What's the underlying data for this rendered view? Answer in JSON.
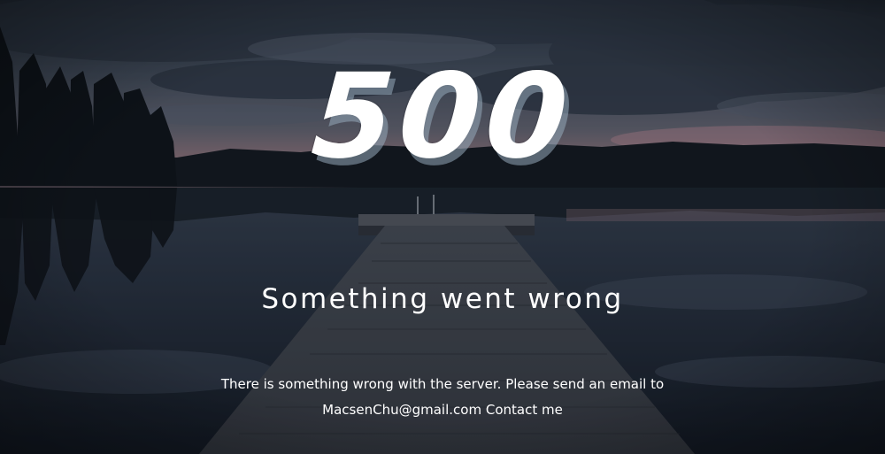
{
  "error_page": {
    "code": "500",
    "headline": "Something went wrong",
    "message_line1": "There is something wrong with the server. Please send an email to",
    "email": "MacsenChu@gmail.com",
    "contact_label": "Contact me"
  },
  "colors": {
    "text": "#ffffff",
    "sky_dark": "#1f2a38",
    "sunset": "#b98a8f",
    "water": "#27323f"
  }
}
